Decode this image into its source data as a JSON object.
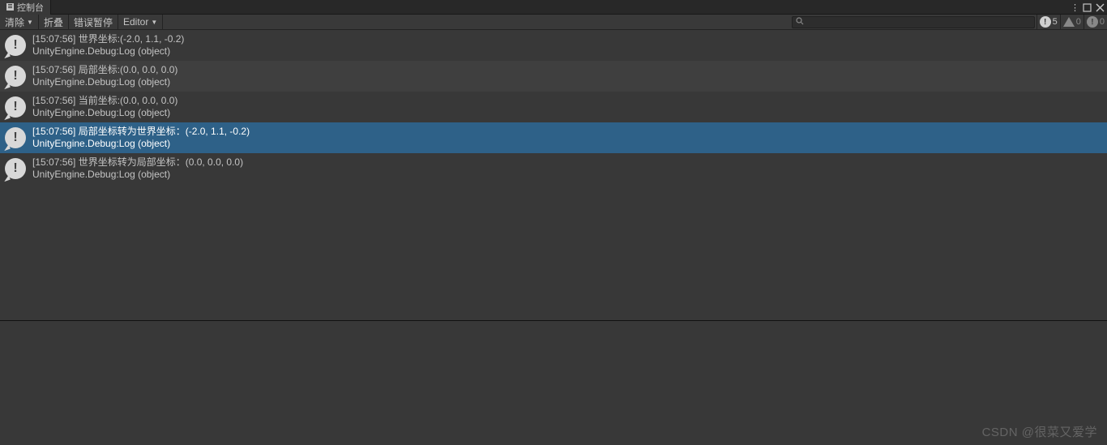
{
  "tab": {
    "title": "控制台"
  },
  "toolbar": {
    "clear": "清除",
    "collapse": "折叠",
    "error_pause": "错误暂停",
    "editor": "Editor"
  },
  "counters": {
    "info": "5",
    "warn": "0",
    "error": "0"
  },
  "logs": [
    {
      "line1": "[15:07:56] 世界坐标:(-2.0, 1.1, -0.2)",
      "line2": "UnityEngine.Debug:Log (object)",
      "selected": false
    },
    {
      "line1": "[15:07:56] 局部坐标:(0.0, 0.0, 0.0)",
      "line2": "UnityEngine.Debug:Log (object)",
      "selected": false
    },
    {
      "line1": "[15:07:56] 当前坐标:(0.0, 0.0, 0.0)",
      "line2": "UnityEngine.Debug:Log (object)",
      "selected": false
    },
    {
      "line1": "[15:07:56] 局部坐标转为世界坐标：(-2.0, 1.1, -0.2)",
      "line2": "UnityEngine.Debug:Log (object)",
      "selected": true
    },
    {
      "line1": "[15:07:56] 世界坐标转为局部坐标：(0.0, 0.0, 0.0)",
      "line2": "UnityEngine.Debug:Log (object)",
      "selected": false
    }
  ],
  "watermark": "CSDN @很菜又爱学"
}
